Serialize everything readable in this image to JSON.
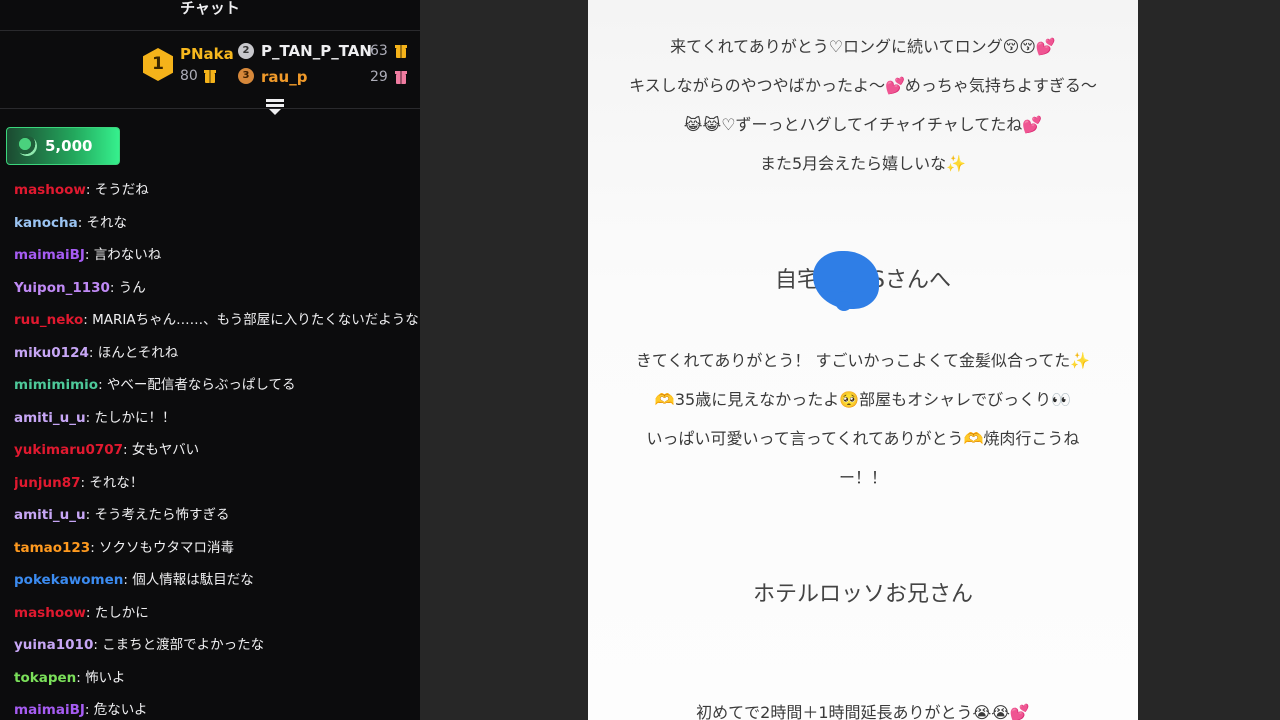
{
  "chat": {
    "title": "チャット",
    "leaderboard": {
      "first": {
        "rank": "1",
        "name": "PNaka",
        "count": "80"
      },
      "second": {
        "rank": "2",
        "name": "P_TAN_P_TAN",
        "count": "63"
      },
      "third": {
        "rank": "3",
        "name": "rau_p",
        "count": "29"
      }
    },
    "points": "5,000",
    "messages": [
      {
        "user": "mashoow",
        "text": ": そうだね",
        "color": "#e0192f"
      },
      {
        "user": "kanocha",
        "text": ": それな",
        "color": "#9bc4f2"
      },
      {
        "user": "maimaiBJ",
        "text": ": 言わないね",
        "color": "#a65cf2"
      },
      {
        "user": "Yuipon_1130",
        "text": ": うん",
        "color": "#c08af5"
      },
      {
        "user": "ruu_neko",
        "text": ": MARIAちゃん……、もう部屋に入りたくないだようなあ",
        "color": "#e0192f"
      },
      {
        "user": "miku0124",
        "text": ": ほんとそれね",
        "color": "#c7a6f5"
      },
      {
        "user": "mimimimio",
        "text": ": やべー配信者ならぶっぱしてる",
        "color": "#4ec99a"
      },
      {
        "user": "amiti_u_u",
        "text": ": たしかに！！",
        "color": "#c7a6f5"
      },
      {
        "user": "yukimaru0707",
        "text": ": 女もヤバい",
        "color": "#e0192f"
      },
      {
        "user": "junjun87",
        "text": ": それな！",
        "color": "#e0192f"
      },
      {
        "user": "amiti_u_u",
        "text": ": そう考えたら怖すぎる",
        "color": "#c7a6f5"
      },
      {
        "user": "tamao123",
        "text": ": ソクソもウタマロ消毒",
        "color": "#ff9a1f"
      },
      {
        "user": "pokekawomen",
        "text": ": 個人情報は駄目だな",
        "color": "#3b8bf0"
      },
      {
        "user": "mashoow",
        "text": ": たしかに",
        "color": "#e0192f"
      },
      {
        "user": "yuina1010",
        "text": ": こまちと渡部でよかったな",
        "color": "#c7a6f5"
      },
      {
        "user": "tokapen",
        "text": ": 怖いよ",
        "color": "#7be05a"
      },
      {
        "user": "maimaiBJ",
        "text": ": 危ないよ",
        "color": "#a65cf2"
      }
    ]
  },
  "note": {
    "para1": [
      "来てくれてありがとう♡ロングに続いてロング😚😚💕",
      "キスしながらのやつやばかったよ〜💕めっちゃ気持ちよすぎる〜",
      "😹😹♡ずーっとハグしてイチャイチャしてたね💕",
      "また5月会えたら嬉しいな✨"
    ],
    "heading2_pre": "自宅",
    "heading2_post": "Sさんへ",
    "para2": [
      "きてくれてありがとう！ すごいかっこよくて金髪似合ってた✨",
      "🫶35歳に見えなかったよ🥺部屋もオシャレでびっくり👀",
      "いっぱい可愛いって言ってくれてありがとう🫶焼肉行こうね",
      "ー！！"
    ],
    "heading3": "ホテルロッソお兄さん",
    "para3": [
      "初めてで2時間＋1時間延長ありがとう😭😭💕"
    ]
  }
}
